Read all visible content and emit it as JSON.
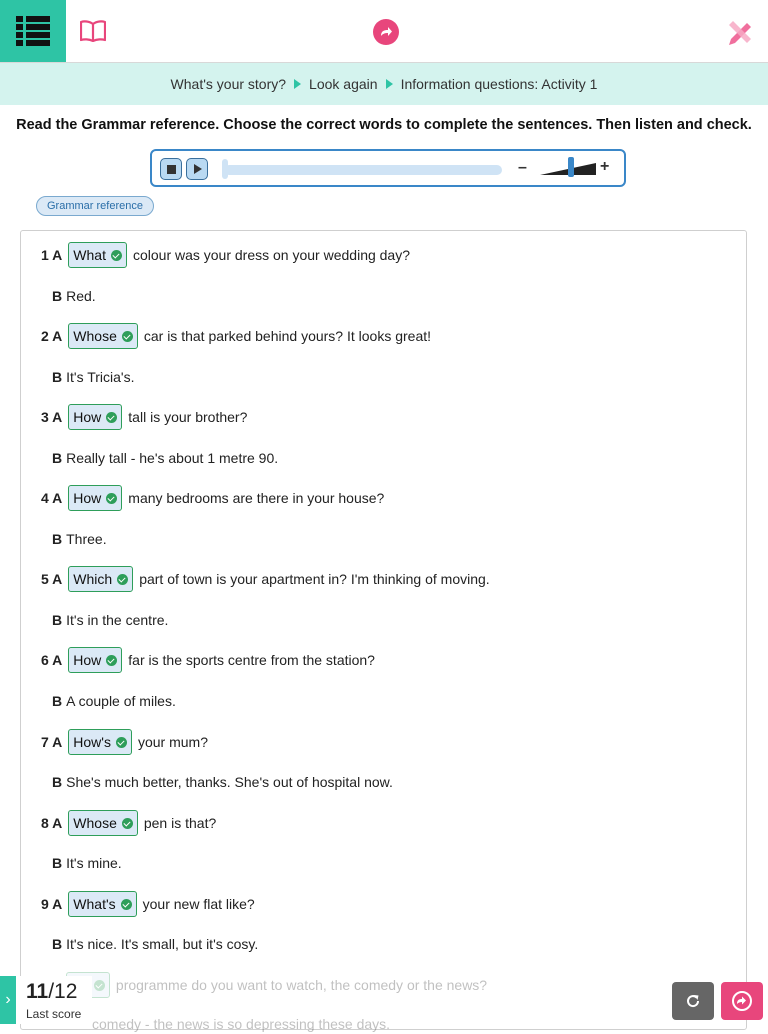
{
  "breadcrumb": [
    "What's your story?",
    "Look again",
    "Information questions: Activity 1"
  ],
  "instruction": "Read the Grammar reference. Choose the correct words to complete the sentences. Then listen and check.",
  "audio": {
    "minus": "–",
    "plus": "+"
  },
  "grammar_button": "Grammar reference",
  "items": [
    {
      "num": "1 A",
      "answer": "What",
      "rest": "colour was your dress on your wedding day?",
      "b": "B",
      "reply": "Red."
    },
    {
      "num": "2 A",
      "answer": "Whose",
      "rest": "car is that parked behind yours? It looks great!",
      "b": "B",
      "reply": "It's Tricia's."
    },
    {
      "num": "3 A",
      "answer": "How",
      "rest": "tall is your brother?",
      "b": "B",
      "reply": "Really tall - he's about 1 metre 90."
    },
    {
      "num": "4 A",
      "answer": "How",
      "rest": "many bedrooms are there in your house?",
      "b": "B",
      "reply": "Three."
    },
    {
      "num": "5 A",
      "answer": "Which",
      "rest": "part of town is your apartment in? I'm thinking of moving.",
      "b": "B",
      "reply": "It's in the centre."
    },
    {
      "num": "6 A",
      "answer": "How",
      "rest": "far is the sports centre from the station?",
      "b": "B",
      "reply": "A couple of miles."
    },
    {
      "num": "7 A",
      "answer": "How's",
      "rest": "your mum?",
      "b": "B",
      "reply": "She's much better, thanks. She's out of hospital now."
    },
    {
      "num": "8 A",
      "answer": "Whose",
      "rest": "pen is that?",
      "b": "B",
      "reply": "It's mine."
    },
    {
      "num": "9 A",
      "answer": "What's",
      "rest": "your new flat like?",
      "b": "B",
      "reply": "It's nice. It's small, but it's cosy."
    },
    {
      "num": "",
      "answer": "ich",
      "rest": "programme do you want to watch, the comedy or the news?",
      "b": "",
      "reply": "comedy - the news is so depressing these days."
    }
  ],
  "score": {
    "value": "11",
    "total": "/12",
    "label": "Last score"
  },
  "colors": {
    "accent": "#2ec4a5",
    "brand": "#e8467c",
    "correct": "#2e9e5a",
    "highlight": "#d4f3ee"
  }
}
